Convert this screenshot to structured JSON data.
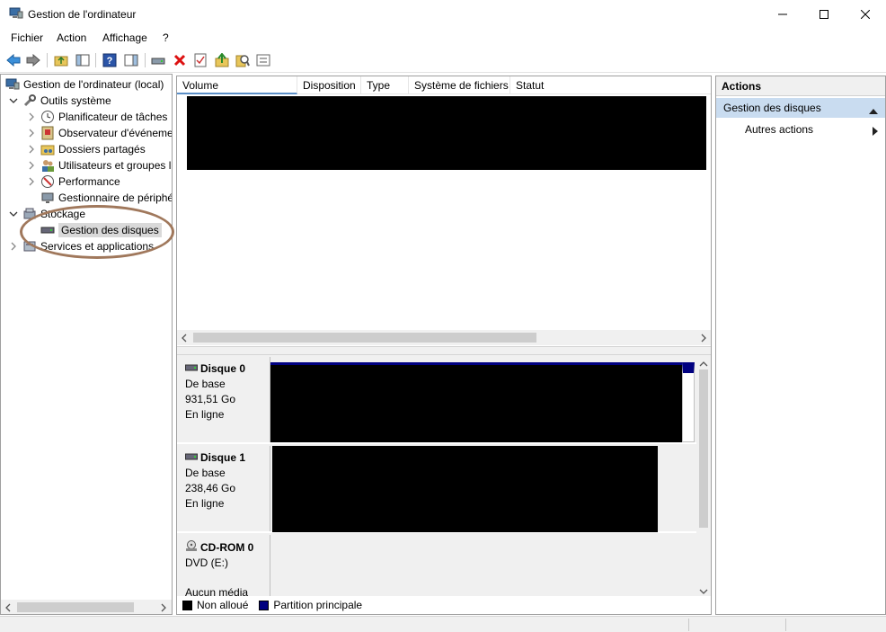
{
  "window": {
    "title": "Gestion de l'ordinateur"
  },
  "menu": [
    "Fichier",
    "Action",
    "Affichage",
    "?"
  ],
  "tree": {
    "root": "Gestion de l'ordinateur (local)",
    "system_tools": "Outils système",
    "system_children": [
      "Planificateur de tâches",
      "Observateur d'événeme",
      "Dossiers partagés",
      "Utilisateurs et groupes l",
      "Performance",
      "Gestionnaire de périphé"
    ],
    "storage": "Stockage",
    "disk_management": "Gestion des disques",
    "services": "Services et applications"
  },
  "volume_columns": [
    "Volume",
    "Disposition",
    "Type",
    "Système de fichiers",
    "Statut"
  ],
  "disks": [
    {
      "name": "Disque 0",
      "type": "De base",
      "size": "931,51 Go",
      "status": "En ligne"
    },
    {
      "name": "Disque 1",
      "type": "De base",
      "size": "238,46 Go",
      "status": "En ligne"
    },
    {
      "name": "CD-ROM 0",
      "type": "DVD (E:)",
      "size": "",
      "status": "Aucun média"
    }
  ],
  "legend": {
    "unallocated": {
      "label": "Non alloué",
      "color": "#000000"
    },
    "primary": {
      "label": "Partition principale",
      "color": "#000080"
    }
  },
  "actions": {
    "header": "Actions",
    "group": "Gestion des disques",
    "more": "Autres actions"
  }
}
